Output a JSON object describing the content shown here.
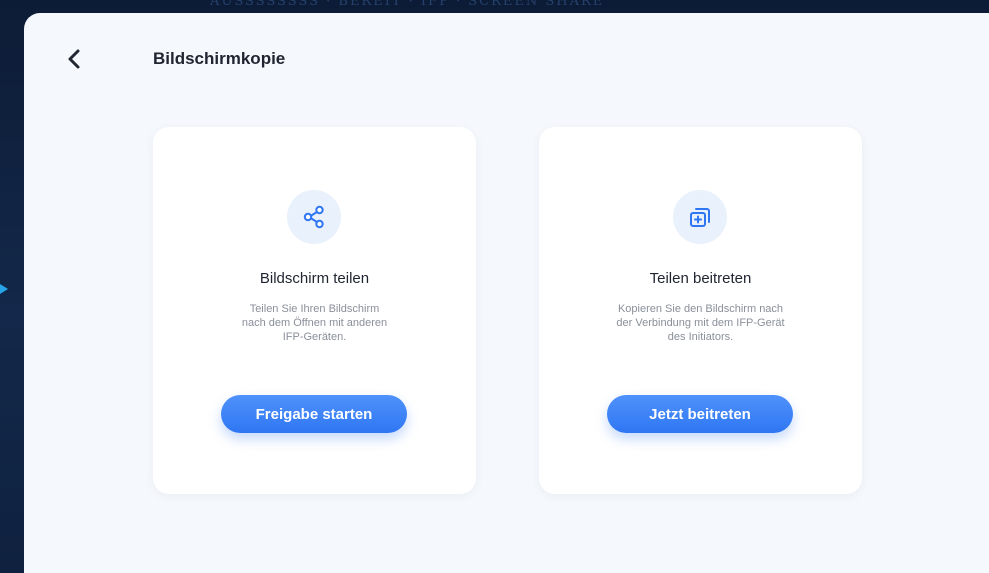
{
  "background": {
    "banner_text": "AUSSSSSSSS  ·  BEREIT  ·  IFP  ·  SCREEN  SHARE"
  },
  "header": {
    "back_icon": "chevron-left-icon",
    "title": "Bildschirmkopie"
  },
  "cards": [
    {
      "icon": "share-icon",
      "title": "Bildschirm teilen",
      "description": "Teilen Sie Ihren Bildschirm\nnach dem Öffnen mit anderen\nIFP-Geräten.",
      "button_label": "Freigabe starten"
    },
    {
      "icon": "add-copy-icon",
      "title": "Teilen beitreten",
      "description": "Kopieren Sie den Bildschirm nach\nder Verbindung mit dem IFP-Gerät\ndes Initiators.",
      "button_label": "Jetzt beitreten"
    }
  ],
  "colors": {
    "accent": "#2f76f3",
    "panel_background": "#f5f8fc",
    "card_background": "#ffffff",
    "icon_circle": "#e9f1fc",
    "title_text": "#1f2430",
    "description_text": "#8a8f99"
  }
}
